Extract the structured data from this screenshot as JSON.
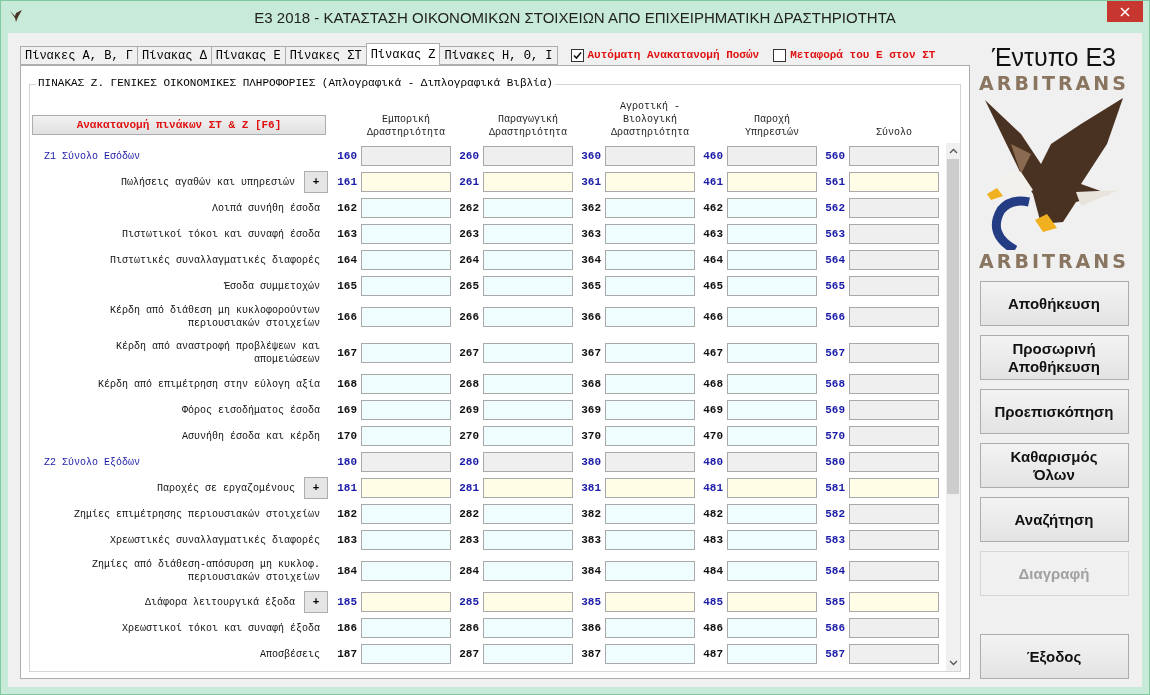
{
  "window": {
    "title": "Ε3 2018 - ΚΑΤΑΣΤΑΣΗ ΟΙΚΟΝΟΜΙΚΩΝ ΣΤΟΙΧΕΙΩΝ ΑΠΟ ΕΠΙΧΕΙΡΗΜΑΤΙΚΗ ΔΡΑΣΤΗΡΙΟΤΗΤΑ"
  },
  "tabs": [
    {
      "label": "Πίνακες Α, Β, Γ",
      "selected": false
    },
    {
      "label": "Πίνακας Δ",
      "selected": false
    },
    {
      "label": "Πίνακας Ε",
      "selected": false
    },
    {
      "label": "Πίνακες ΣΤ",
      "selected": false
    },
    {
      "label": "Πίνακας Ζ",
      "selected": true
    },
    {
      "label": "Πίνακες Η, Θ, Ι",
      "selected": false
    }
  ],
  "options": [
    {
      "label": "Αυτόματη Ανακατανομή Ποσών",
      "checked": true
    },
    {
      "label": "Μεταφορά του Ε στον ΣΤ",
      "checked": false
    }
  ],
  "group": {
    "title": "ΠΙΝΑΚΑΣ Ζ. ΓΕΝΙΚΕΣ ΟΙΚΟΝΟΜΙΚΕΣ ΠΛΗΡΟΦΟΡΙΕΣ (Απλογραφικά - Διπλογραφικά Βιβλία)"
  },
  "redistribute_button": "Ανακατανομή πινάκων ΣΤ & Ζ [F6]",
  "columns": [
    "Εμπορική\nΔραστηριότητα",
    "Παραγωγική\nΔραστηριότητα",
    "Αγροτική -\nΒιολογική\nΔραστηριότητα",
    "Παροχή\nΥπηρεσιών",
    "Σύνολο"
  ],
  "rows": [
    {
      "kind": "total",
      "label": "Ζ1 Σύνολο Εσόδων",
      "codes": [
        "160",
        "260",
        "360",
        "460",
        "560"
      ]
    },
    {
      "kind": "plus",
      "label": "Πωλήσεις αγαθών και υπηρεσιών",
      "button": "+",
      "codes": [
        "161",
        "261",
        "361",
        "461",
        "561"
      ]
    },
    {
      "kind": "item",
      "label": "Λοιπά συνήθη έσοδα",
      "codes": [
        "162",
        "262",
        "362",
        "462",
        "562"
      ]
    },
    {
      "kind": "item",
      "label": "Πιστωτικοί τόκοι και συναφή έσοδα",
      "codes": [
        "163",
        "263",
        "363",
        "463",
        "563"
      ]
    },
    {
      "kind": "item",
      "label": "Πιστωτικές συναλλαγματικές διαφορές",
      "codes": [
        "164",
        "264",
        "364",
        "464",
        "564"
      ]
    },
    {
      "kind": "item",
      "label": "Έσοδα συμμετοχών",
      "codes": [
        "165",
        "265",
        "365",
        "465",
        "565"
      ]
    },
    {
      "kind": "item",
      "label": "Κέρδη από διάθεση μη κυκλοφορούντων\nπεριουσιακών στοιχείων",
      "codes": [
        "166",
        "266",
        "366",
        "466",
        "566"
      ]
    },
    {
      "kind": "item",
      "label": "Κέρδη από αναστροφή προβλέψεων και\nαπομειώσεων",
      "codes": [
        "167",
        "267",
        "367",
        "467",
        "567"
      ]
    },
    {
      "kind": "item",
      "label": "Κέρδη από επιμέτρηση στην εύλογη αξία",
      "codes": [
        "168",
        "268",
        "368",
        "468",
        "568"
      ]
    },
    {
      "kind": "item",
      "label": "Φόρος εισοδήματος έσοδα",
      "codes": [
        "169",
        "269",
        "369",
        "469",
        "569"
      ]
    },
    {
      "kind": "item",
      "label": "Ασυνήθη έσοδα και κέρδη",
      "codes": [
        "170",
        "270",
        "370",
        "470",
        "570"
      ]
    },
    {
      "kind": "total",
      "label": "Ζ2 Σύνολο Εξόδων",
      "codes": [
        "180",
        "280",
        "380",
        "480",
        "580"
      ]
    },
    {
      "kind": "plus",
      "label": "Παροχές σε εργαζομένους",
      "button": "+",
      "codes": [
        "181",
        "281",
        "381",
        "481",
        "581"
      ]
    },
    {
      "kind": "item",
      "label": "Ζημίες επιμέτρησης περιουσιακών στοιχείων",
      "codes": [
        "182",
        "282",
        "382",
        "482",
        "582"
      ]
    },
    {
      "kind": "item",
      "label": "Χρεωστικές συναλλαγματικές διαφορές",
      "codes": [
        "183",
        "283",
        "383",
        "483",
        "583"
      ]
    },
    {
      "kind": "item",
      "label": "Ζημίες από διάθεση-απόσυρση μη κυκλοφ.\nπεριουσιακών στοιχείων",
      "codes": [
        "184",
        "284",
        "384",
        "484",
        "584"
      ]
    },
    {
      "kind": "plus",
      "label": "Διάφορα λειτουργικά έξοδα",
      "button": "+",
      "codes": [
        "185",
        "285",
        "385",
        "485",
        "585"
      ]
    },
    {
      "kind": "item",
      "label": "Χρεωστικοί τόκοι και συναφή έξοδα",
      "codes": [
        "186",
        "286",
        "386",
        "486",
        "586"
      ]
    },
    {
      "kind": "item",
      "label": "Αποσβέσεις",
      "codes": [
        "187",
        "287",
        "387",
        "487",
        "587"
      ]
    }
  ],
  "side": {
    "form_title": "Έντυπο Ε3",
    "brand_top": "ARBITRANS",
    "brand_bottom": "ARBITRANS",
    "buttons": [
      {
        "label": "Αποθήκευση",
        "disabled": false
      },
      {
        "label": "Προσωρινή\nΑποθήκευση",
        "disabled": false
      },
      {
        "label": "Προεπισκόπηση",
        "disabled": false
      },
      {
        "label": "Καθαρισμός\nΌλων",
        "disabled": false
      },
      {
        "label": "Αναζήτηση",
        "disabled": false
      },
      {
        "label": "Διαγραφή",
        "disabled": true
      }
    ],
    "exit_button": {
      "label": "Έξοδος",
      "disabled": false
    }
  }
}
